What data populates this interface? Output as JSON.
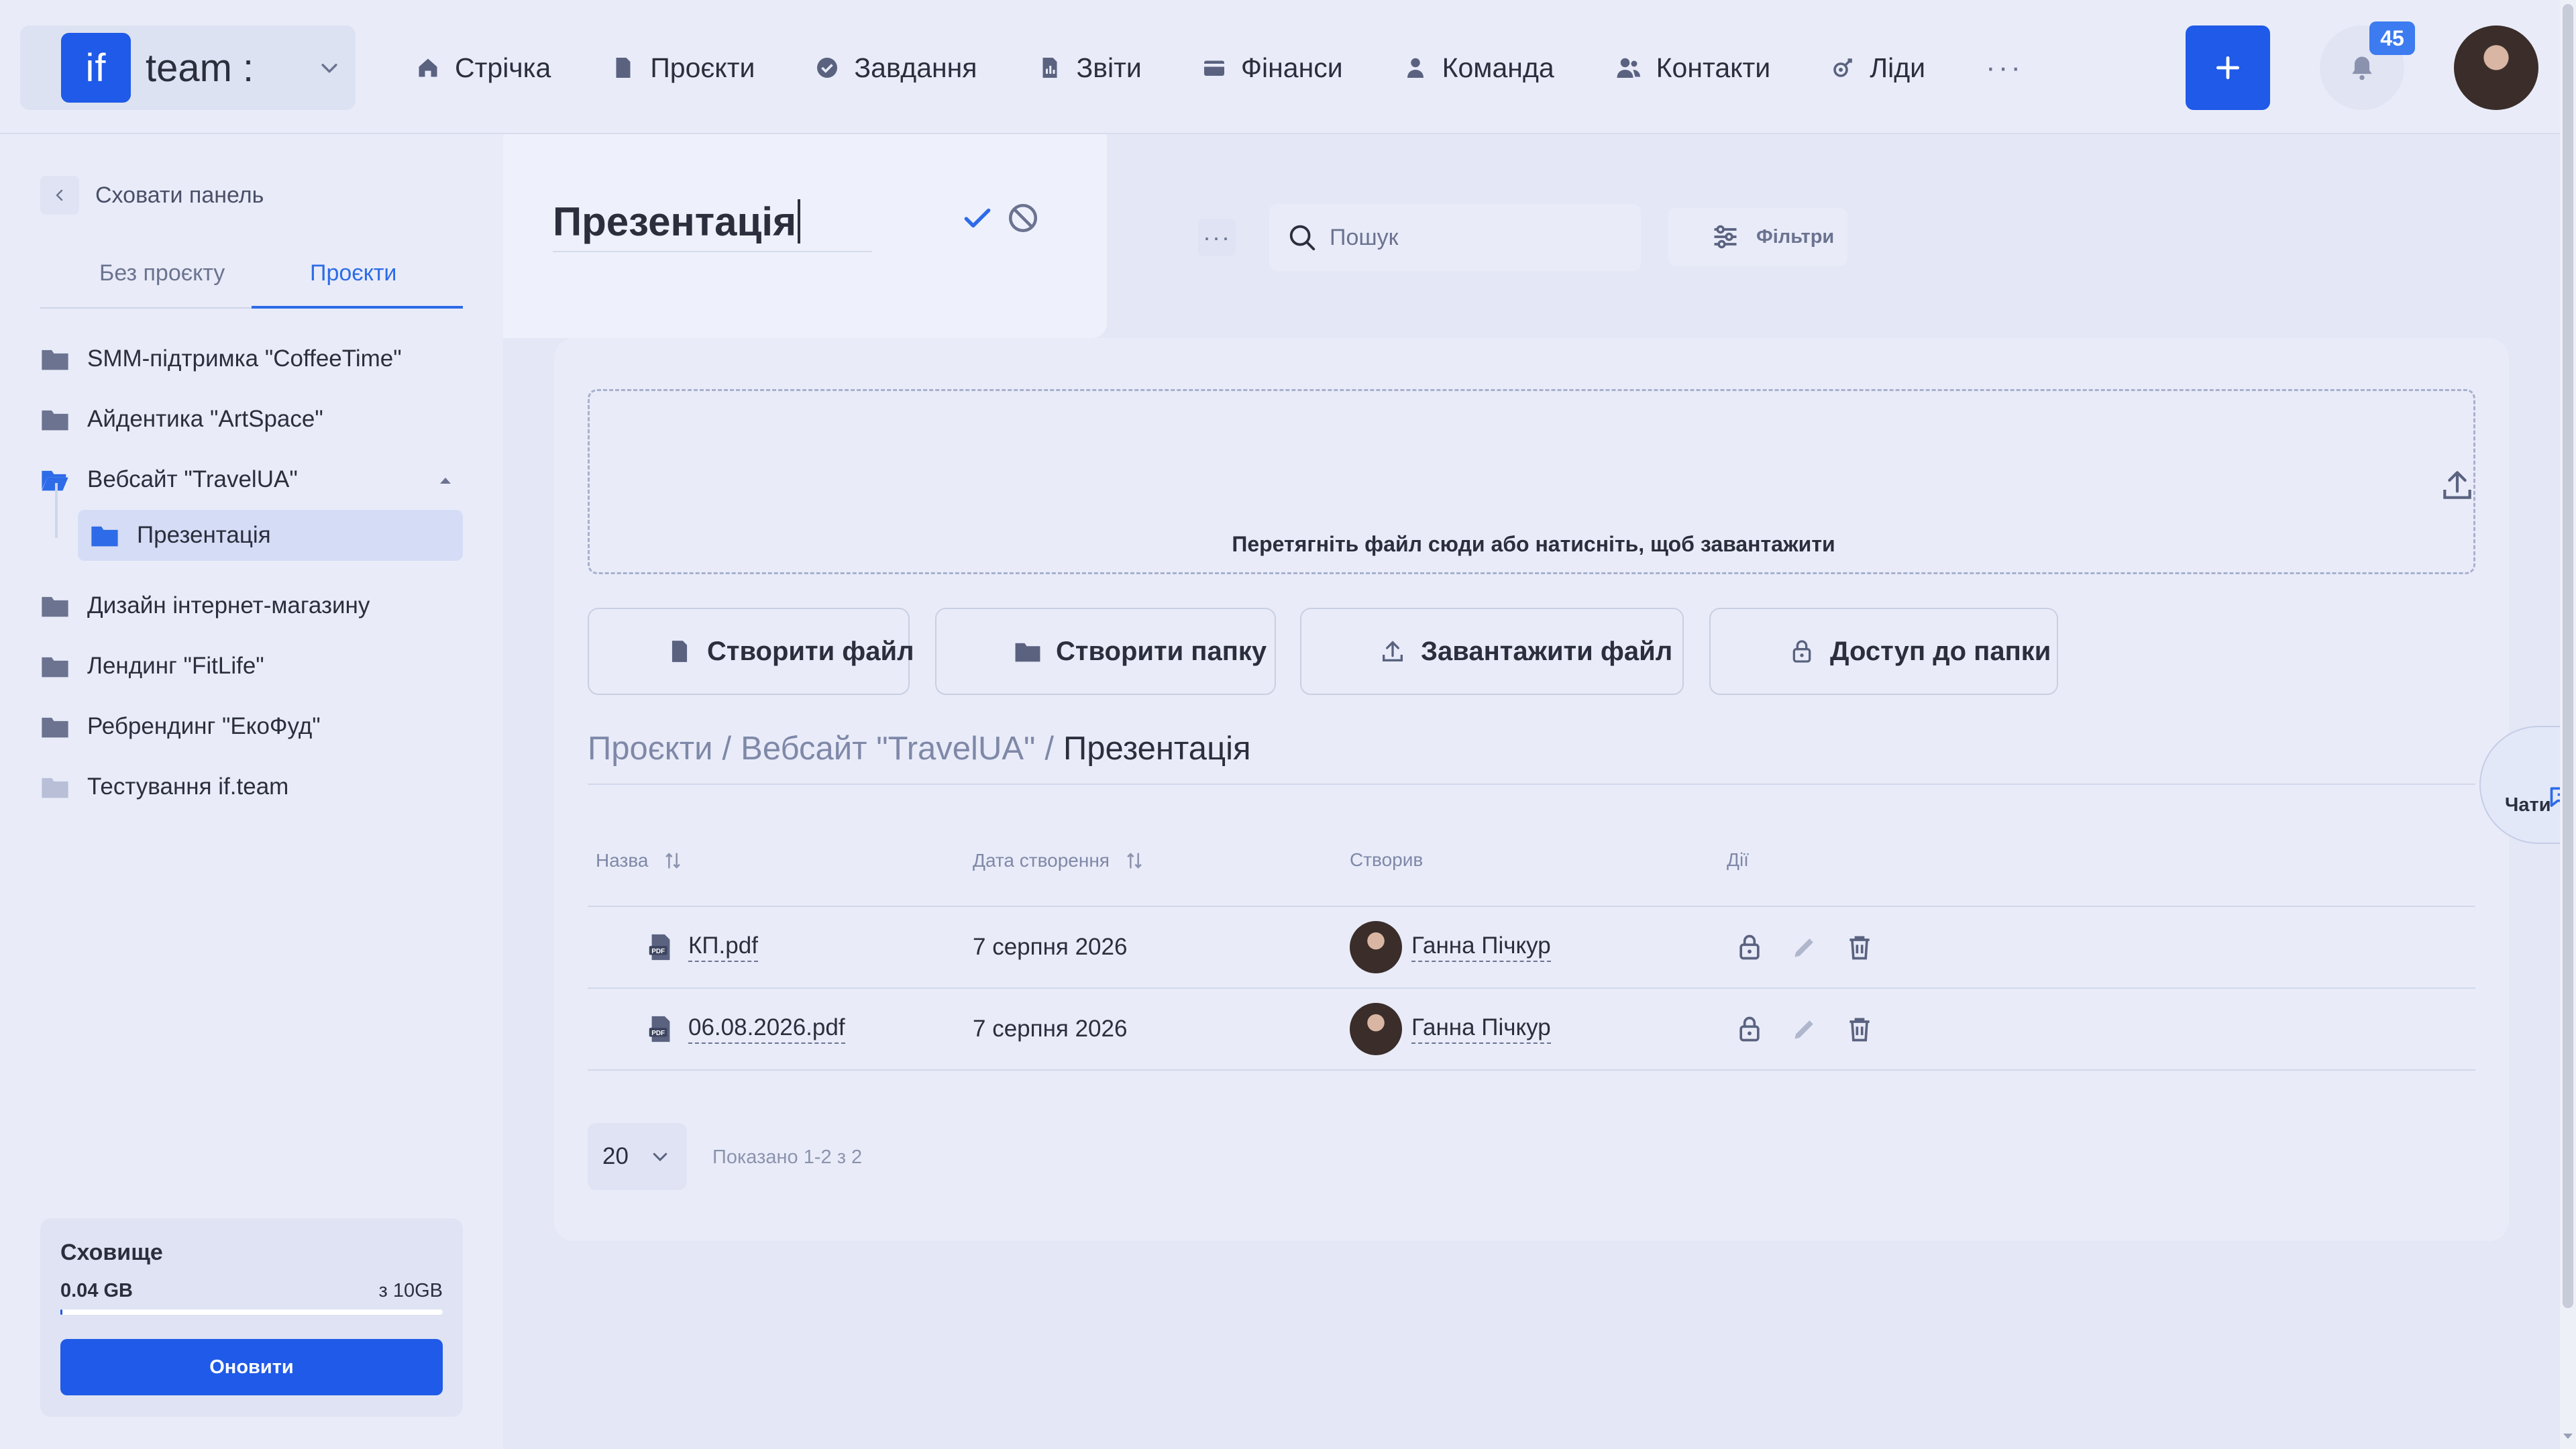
{
  "brand": {
    "logo": "if",
    "name": "team :"
  },
  "nav": [
    {
      "label": "Стрічка",
      "icon": "home-icon"
    },
    {
      "label": "Проєкти",
      "icon": "document-icon"
    },
    {
      "label": "Завдання",
      "icon": "check-circle-icon"
    },
    {
      "label": "Звіти",
      "icon": "report-icon"
    },
    {
      "label": "Фінанси",
      "icon": "wallet-icon"
    },
    {
      "label": "Команда",
      "icon": "person-icon"
    },
    {
      "label": "Контакти",
      "icon": "contacts-icon"
    },
    {
      "label": "Ліди",
      "icon": "leads-icon"
    }
  ],
  "nav_more": "···",
  "notifications": {
    "count": "45"
  },
  "sidebar": {
    "hide_label": "Сховати панель",
    "tabs": [
      "Без проєкту",
      "Проєкти"
    ],
    "active_tab": "Проєкти",
    "projects": [
      "SMM-підтримка \"CoffeeTime\"",
      "Айдентика \"ArtSpace\"",
      "Вебсайт \"TravelUA\"",
      "Дизайн інтернет-магазину",
      "Лендинг \"FitLife\"",
      "Ребрендинг \"ЕкоФуд\"",
      "Тестування if.team"
    ],
    "subfolder": "Презентація",
    "storage": {
      "title": "Сховище",
      "used": "0.04 GB",
      "total": "з 10GB",
      "used_fraction": 0.004,
      "button": "Оновити"
    }
  },
  "title_edit": {
    "value": "Презентація"
  },
  "toolbar": {
    "more": "···",
    "search_placeholder": "Пошук",
    "filters": "Фільтри"
  },
  "dropzone": {
    "text": "Перетягніть файл сюди або натисніть, щоб завантажити"
  },
  "actions": {
    "create_file": "Створити файл",
    "create_folder": "Створити папку",
    "upload_file": "Завантажити файл",
    "folder_access": "Доступ до папки"
  },
  "breadcrumb": {
    "items": [
      "Проєкти",
      "Вебсайт \"TravelUA\""
    ],
    "separator": "/",
    "current": "Презентація"
  },
  "table": {
    "headers": {
      "name": "Назва",
      "created": "Дата створення",
      "creator": "Створив",
      "actions": "Дії"
    },
    "rows": [
      {
        "name": "КП.pdf",
        "date": "7 серпня 2026",
        "creator": "Ганна Пічкур"
      },
      {
        "name": "06.08.2026.pdf",
        "date": "7 серпня 2026",
        "creator": "Ганна Пічкур"
      }
    ]
  },
  "pagination": {
    "per_page": "20",
    "shown": "Показано 1-2 з 2"
  },
  "chats": {
    "label": "Чати"
  },
  "colors": {
    "accent": "#1f5ae8",
    "background": "#e3e7f6",
    "badge": "#3c7bf0"
  }
}
